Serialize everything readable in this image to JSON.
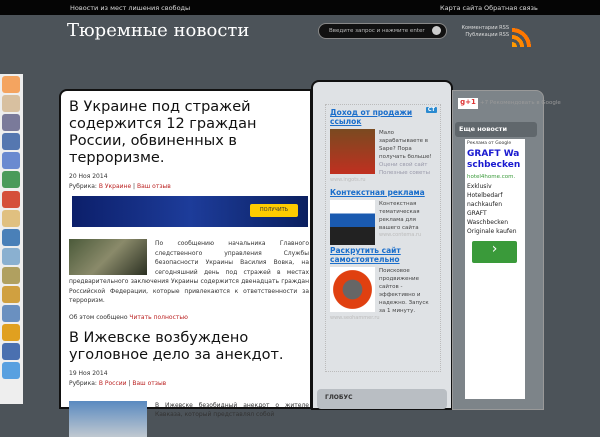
{
  "topbar": {
    "tagline": "Новости из мест лишения свободы",
    "sitemap": "Карта сайта",
    "feedback": "Обратная связь"
  },
  "header": {
    "title": "Тюремные новости",
    "search_placeholder": "Введите запрос и нажмите enter",
    "rss_comments": "Комментарии RSS",
    "rss_posts": "Публикации RSS"
  },
  "social_colors": [
    "#f4a460",
    "#d8c0a0",
    "#7a7a9a",
    "#5577b0",
    "#6a8ad0",
    "#4a9a5a",
    "#d5503a",
    "#e0c080",
    "#4a80b8",
    "#8ab0d0",
    "#b0a060",
    "#d0a040",
    "#6a90c0",
    "#e0a020",
    "#4a70b0",
    "#58a0e0"
  ],
  "posts": [
    {
      "title": "В Украине под стражей содержится 12 граждан России, обвиненных в терроризме.",
      "date": "20 Ноя 2014",
      "rubric_label": "Рубрика:",
      "category": "В Украине",
      "comment": "Ваш отзыв",
      "banner_button": "ПОЛУЧИТЬ",
      "text": "По сообщению начальника Главного следственного управления Службы безопасности Украины Василия Вовка, на сегодняшний день под стражей в местах предварительного заключения Украины содержится двенадцать граждан Российской Федерации, которые привлекаются к ответственности за терроризм.",
      "more_prefix": "Об этом сообщено",
      "more_link": "Читать полностью"
    },
    {
      "title": "В Ижевске возбуждено уголовное дело за анекдот.",
      "date": "19 Ноя 2014",
      "rubric_label": "Рубрика:",
      "category": "В России",
      "comment": "Ваш отзыв",
      "text": "В Ижевске безобидный анекдот о жителе Кавказа, который представлял собой"
    }
  ],
  "ads": [
    {
      "title": "Доход от продажи ссылок",
      "text": "Мало зарабатываете в Sape? Пора получать больше!",
      "extra": "Оцени свой сайт  Полезные советы",
      "site": "www.ingots.ru"
    },
    {
      "title": "Контекстная реклама",
      "text": "Контекстная тематическая реклама для вашего сайта",
      "site": "www.contema.ru"
    },
    {
      "title": "Раскрутить сайт самостоятельно",
      "text": "Поисковое продвижение сайтов - эффективно и надежно. Запуск за 1 минуту.",
      "site": "www.seohammer.ru"
    }
  ],
  "ad_badge": "CT",
  "globus": "ГЛОБУС",
  "right": {
    "gplus": "g+1",
    "gplus_text": "+7  Рекомендовать в Google",
    "more_news": "Еще новости",
    "ad_label": "Реклама от Google",
    "ad_title": "GRAFT Waschbecken",
    "ad_domain": "hotel4home.com.",
    "ad_text": "Exklusiv Hotelbedarf nachkaufen GRAFT Waschbecken Originale kaufen",
    "ad_button": "›"
  }
}
